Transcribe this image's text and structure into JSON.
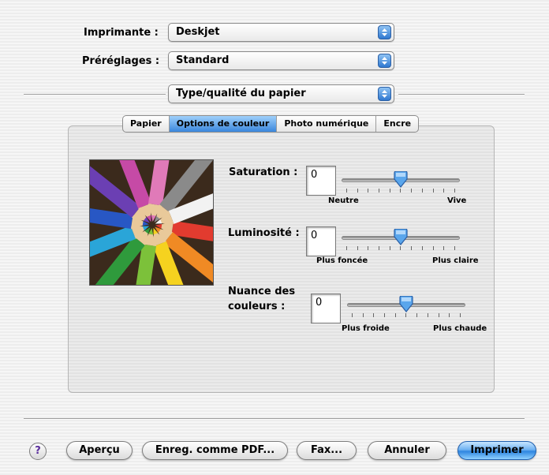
{
  "printer": {
    "label": "Imprimante :",
    "value": "Deskjet"
  },
  "presets": {
    "label": "Préréglages :",
    "value": "Standard"
  },
  "panel_menu": {
    "value": "Type/qualité du papier"
  },
  "tabs": [
    {
      "label": "Papier",
      "active": false
    },
    {
      "label": "Options de couleur",
      "active": true
    },
    {
      "label": "Photo numérique",
      "active": false
    },
    {
      "label": "Encre",
      "active": false
    }
  ],
  "saturation": {
    "label": "Saturation :",
    "value": "0",
    "min_label": "Neutre",
    "max_label": "Vive",
    "level": 0.5
  },
  "brightness": {
    "label": "Luminosité :",
    "value": "0",
    "min_label": "Plus foncée",
    "max_label": "Plus claire",
    "level": 0.5
  },
  "hue": {
    "label_line1": "Nuance des",
    "label_line2": "couleurs :",
    "value": "0",
    "min_label": "Plus froide",
    "max_label": "Plus chaude",
    "level": 0.5
  },
  "buttons": {
    "help": "?",
    "preview": "Aperçu",
    "save_pdf": "Enreg. comme PDF...",
    "fax": "Fax...",
    "cancel": "Annuler",
    "print": "Imprimer"
  },
  "colors": {
    "accent": "#3a86dc",
    "pencils": [
      "#e23b2f",
      "#f08a24",
      "#f5d21f",
      "#7cc13a",
      "#2f9a3c",
      "#2aa5d8",
      "#2857c4",
      "#6b3fb3",
      "#c64aa6",
      "#e07ab8",
      "#8a8a8a",
      "#f2f2f2"
    ]
  }
}
